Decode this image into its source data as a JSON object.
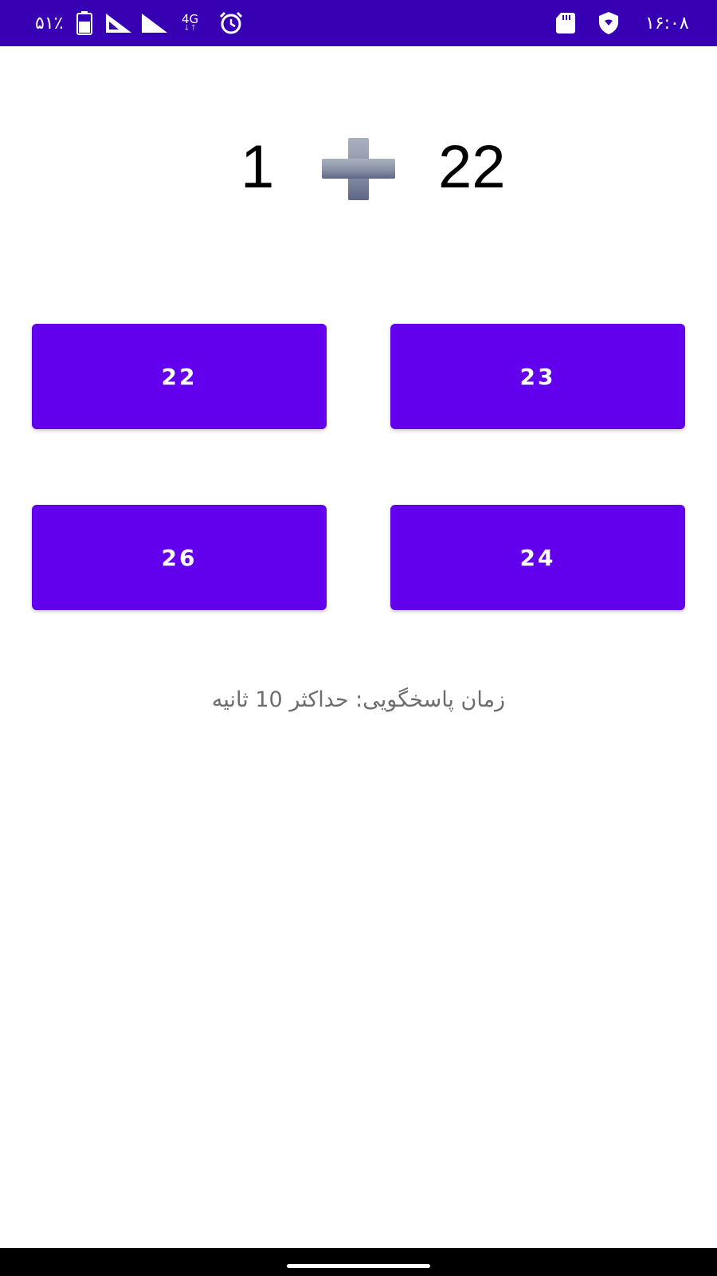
{
  "status_bar": {
    "battery_percent": "۵۱٪",
    "network": "4G",
    "network_arrows": "↓↑",
    "time": "۱۶:۰۸",
    "icons": [
      "battery-icon",
      "signal-icon",
      "signal-icon",
      "alarm-icon",
      "sd-card-icon",
      "vpn-shield-icon"
    ]
  },
  "question": {
    "left_operand": "1",
    "operator_icon": "plus-icon",
    "right_operand": "22"
  },
  "answers": [
    {
      "label": "22"
    },
    {
      "label": "23"
    },
    {
      "label": "26"
    },
    {
      "label": "24"
    }
  ],
  "hint": "زمان پاسخگویی: حداکثر 10 ثانیه",
  "colors": {
    "status_bar": "#3700b3",
    "button": "#6200ee",
    "hint_text": "#6d6d6d"
  }
}
